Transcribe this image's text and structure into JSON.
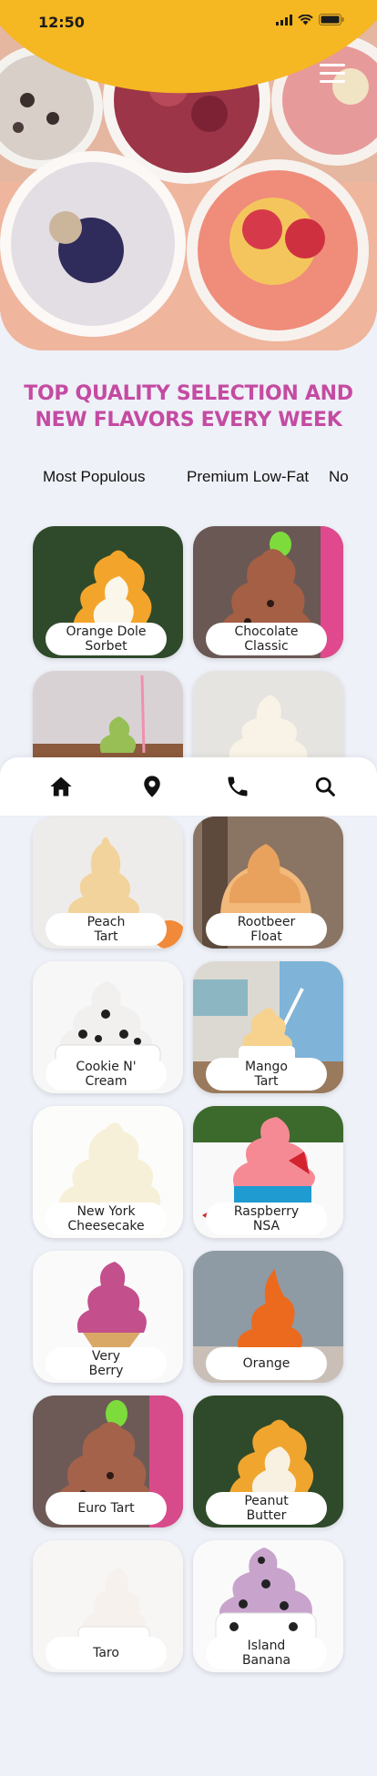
{
  "status_bar": {
    "time": "12:50"
  },
  "header": {
    "menu_icon": "hamburger-menu-icon"
  },
  "headline": {
    "line1": "TOP QUALITY SELECTION AND",
    "line2": "NEW FLAVORS EVERY WEEK"
  },
  "tabs": [
    {
      "label": "Most Populous"
    },
    {
      "label": "Premium Low-Fat"
    },
    {
      "label": "No"
    }
  ],
  "flavors": [
    {
      "line1": "Orange Dole",
      "line2": "Sorbet"
    },
    {
      "line1": "Chocolate",
      "line2": "Classic"
    },
    {
      "line1": "",
      "line2": ""
    },
    {
      "line1": "",
      "line2": ""
    },
    {
      "line1": "Peach",
      "line2": "Tart"
    },
    {
      "line1": "Rootbeer",
      "line2": "Float"
    },
    {
      "line1": "Cookie N'",
      "line2": "Cream"
    },
    {
      "line1": "Mango",
      "line2": "Tart"
    },
    {
      "line1": "New York",
      "line2": "Cheesecake"
    },
    {
      "line1": "Raspberry",
      "line2": "NSA"
    },
    {
      "line1": "Very",
      "line2": "Berry"
    },
    {
      "line1": "Orange",
      "line2": ""
    },
    {
      "line1": "Euro Tart",
      "line2": ""
    },
    {
      "line1": "Peanut",
      "line2": "Butter"
    },
    {
      "line1": "Taro",
      "line2": ""
    },
    {
      "line1": "Island",
      "line2": "Banana"
    }
  ],
  "bottom_nav": [
    {
      "icon": "home-icon"
    },
    {
      "icon": "location-pin-icon"
    },
    {
      "icon": "phone-icon"
    },
    {
      "icon": "search-icon"
    }
  ],
  "colors": {
    "accent_yellow": "#f5b722",
    "headline_pink": "#c44ba2",
    "page_bg": "#eff1f8"
  }
}
